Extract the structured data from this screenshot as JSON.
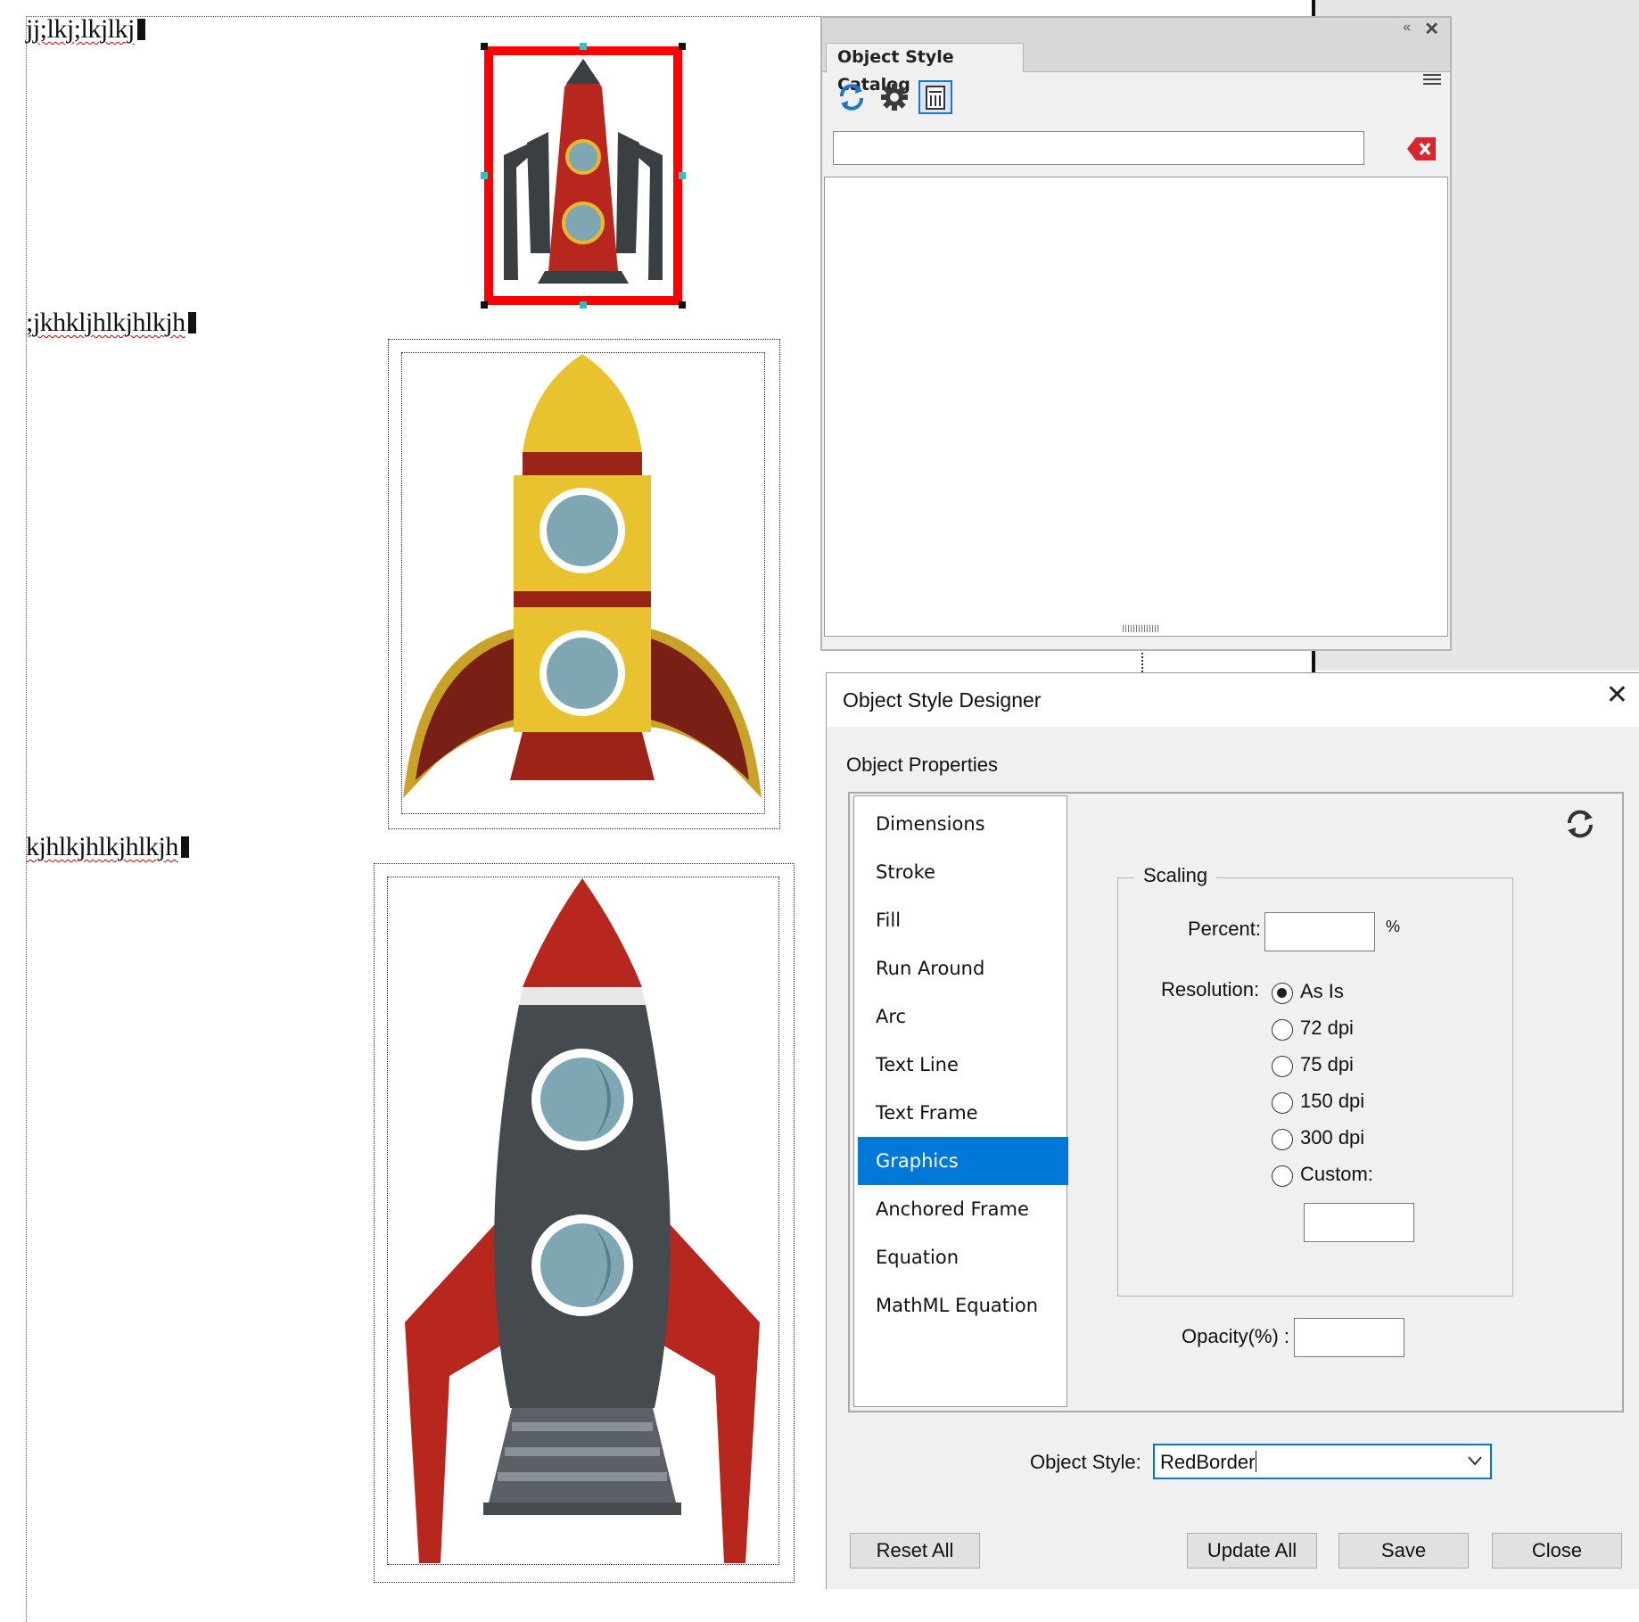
{
  "document": {
    "lines": [
      {
        "text": "jj;lkj;lkjlkj"
      },
      {
        "text": ";jkhkljhlkjhlkjh"
      },
      {
        "text": "kjhlkjhlkjhlkjh"
      }
    ],
    "images": [
      {
        "name": "rocket-red",
        "selected": true,
        "border_color": "#ff0000"
      },
      {
        "name": "rocket-yellow",
        "selected": false
      },
      {
        "name": "rocket-gray",
        "selected": false
      }
    ]
  },
  "catalog": {
    "title": "Object Style Catalog",
    "collapse_glyph": "«",
    "close_glyph": "✕",
    "toolbar": [
      {
        "icon": "refresh-icon"
      },
      {
        "icon": "gear-icon"
      },
      {
        "icon": "delete-list-icon"
      }
    ],
    "search": {
      "value": "",
      "placeholder": ""
    },
    "clear_icon": "clear-search-icon"
  },
  "designer": {
    "title": "Object Style Designer",
    "close_glyph": "✕",
    "section_label": "Object Properties",
    "nav_items": [
      {
        "label": "Dimensions",
        "selected": false
      },
      {
        "label": "Stroke",
        "selected": false
      },
      {
        "label": "Fill",
        "selected": false
      },
      {
        "label": "Run Around",
        "selected": false
      },
      {
        "label": "Arc",
        "selected": false
      },
      {
        "label": "Text Line",
        "selected": false
      },
      {
        "label": "Text Frame",
        "selected": false
      },
      {
        "label": "Graphics",
        "selected": true
      },
      {
        "label": "Anchored Frame",
        "selected": false
      },
      {
        "label": "Equation",
        "selected": false
      },
      {
        "label": "MathML Equation",
        "selected": false
      }
    ],
    "scaling": {
      "legend": "Scaling",
      "percent_label": "Percent:",
      "percent_value": "",
      "percent_unit": "%",
      "resolution_label": "Resolution:",
      "resolutions": [
        {
          "label": "As Is",
          "checked": true
        },
        {
          "label": "72 dpi",
          "checked": false
        },
        {
          "label": "75 dpi",
          "checked": false
        },
        {
          "label": "150 dpi",
          "checked": false
        },
        {
          "label": "300 dpi",
          "checked": false
        },
        {
          "label": "Custom:",
          "checked": false
        }
      ],
      "custom_value": ""
    },
    "opacity_label": "Opacity(%) :",
    "opacity_value": "",
    "object_style_label": "Object Style:",
    "object_style_value": "RedBorder",
    "buttons": {
      "reset_all": "Reset All",
      "update_all": "Update All",
      "save": "Save",
      "close": "Close"
    },
    "colors": {
      "selection": "#0078d7"
    }
  }
}
